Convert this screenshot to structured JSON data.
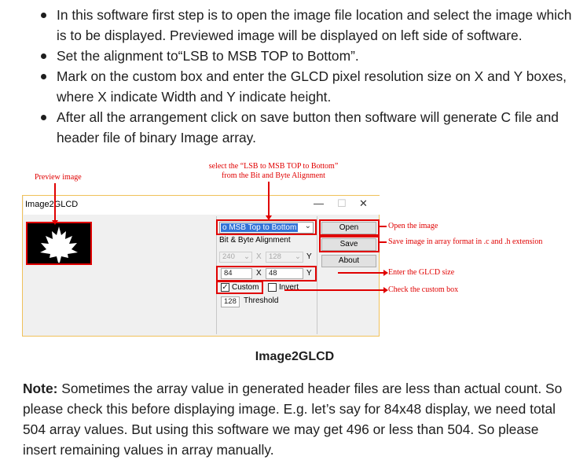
{
  "bullets": [
    "In this software first step is to open the image file location and select the image which is to be displayed. Previewed image will be displayed on left side of software.",
    "Set the alignment to“LSB to MSB TOP to Bottom”.",
    "Mark on the custom box and enter the GLCD pixel resolution size on X and Y boxes, where X indicate Width and Y indicate height.",
    "After all the arrangement click on save button then software will generate C file and header file of binary Image array."
  ],
  "figure": {
    "annotations": {
      "preview": "Preview image",
      "alignment_line1": "select the “LSB to MSB TOP to Bottom”",
      "alignment_line2": "from the Bit and Byte Alignment",
      "open": "Open the image",
      "save": "Save image in array format in .c and .h extension",
      "size": "Enter the GLCD size",
      "custom": "Check the custom box"
    },
    "window": {
      "title": "Image2GLCD",
      "minimize": "—",
      "maximize": "☐",
      "close": "✕",
      "alignment_value": "o MSB Top to Bottom",
      "alignment_label": "Bit & Byte Alignment",
      "preset_x": "240",
      "preset_y": "128",
      "x_label": "X",
      "y_label": "Y",
      "width_value": "84",
      "height_value": "48",
      "custom_label": "Custom",
      "custom_checked": "✓",
      "invert_label": "Invert",
      "threshold_value": "128",
      "threshold_label": "Threshold",
      "open_button": "Open",
      "save_button": "Save",
      "about_button": "About"
    },
    "caption": "Image2GLCD"
  },
  "note": {
    "label": "Note:",
    "text": " Sometimes the array value in generated header files are less than actual count. So please check this before displaying image. E.g. let’s say for 84x48 display, we need total 504 array values. But using this software we may get 496 or less than 504. So please insert remaining values in array manually."
  },
  "colors": {
    "annotation": "#e00000",
    "selection": "#3373d7",
    "window_border": "#f0c15a"
  }
}
